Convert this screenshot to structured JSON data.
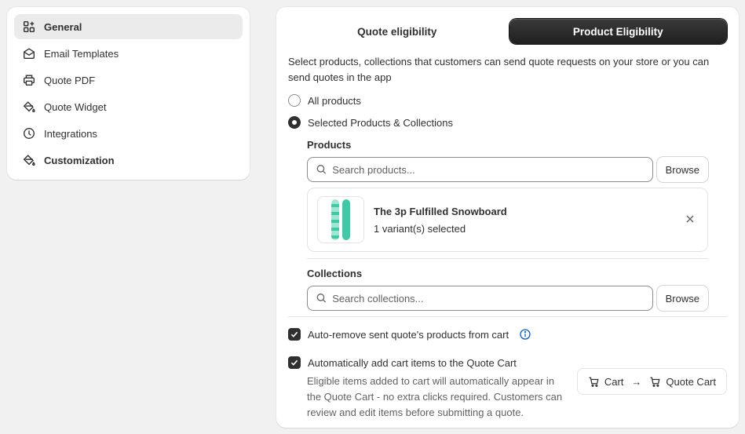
{
  "sidebar": {
    "items": [
      {
        "label": "General",
        "icon": "grid-icon"
      },
      {
        "label": "Email Templates",
        "icon": "mail-icon"
      },
      {
        "label": "Quote PDF",
        "icon": "printer-icon"
      },
      {
        "label": "Quote Widget",
        "icon": "paint-bucket-icon"
      },
      {
        "label": "Integrations",
        "icon": "clock-icon"
      },
      {
        "label": "Customization",
        "icon": "paint-bucket-icon"
      }
    ]
  },
  "tabs": [
    {
      "label": "Quote eligibility",
      "selected": false
    },
    {
      "label": "Product Eligibility",
      "selected": true
    }
  ],
  "description": "Select products, collections that customers can send quote requests on your store or you can send quotes in the app",
  "radio": {
    "all_products": "All products",
    "selected": "Selected Products & Collections",
    "value": "selected"
  },
  "products": {
    "title": "Products",
    "search_placeholder": "Search products...",
    "browse_label": "Browse",
    "items": [
      {
        "title": "The 3p Fulfilled Snowboard",
        "subtitle": "1 variant(s) selected"
      }
    ]
  },
  "collections": {
    "title": "Collections",
    "search_placeholder": "Search collections...",
    "browse_label": "Browse"
  },
  "options": {
    "auto_remove": {
      "label": "Auto-remove sent quote's products from cart",
      "checked": true
    },
    "auto_add": {
      "label": "Automatically add cart items to the Quote Cart",
      "checked": true,
      "help": "Eligible items added to cart will automatically appear in the Quote Cart - no extra clicks required. Customers can review and edit items before submitting a quote."
    }
  },
  "cart_pill": {
    "from": "Cart",
    "arrow": "→",
    "to": "Quote Cart"
  },
  "colors": {
    "accent_dark": "#303030",
    "info_blue": "#005bd3",
    "snowboard": "#3ec9a7"
  }
}
